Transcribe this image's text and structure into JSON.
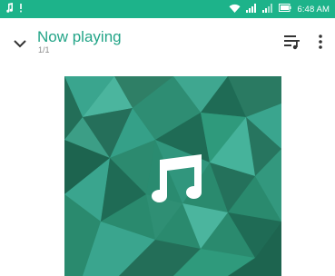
{
  "status_bar": {
    "time": "6:48 AM",
    "background": "#1db38a",
    "icons": [
      "music-note-icon",
      "alert-icon",
      "wifi-icon",
      "sim1-signal-icon",
      "sim2-signal-icon",
      "battery-icon"
    ]
  },
  "toolbar": {
    "title": "Now playing",
    "subtitle": "1/1",
    "accent": "#22a487",
    "icons": [
      "chevron-down-icon",
      "queue-music-icon",
      "more-vert-icon"
    ]
  },
  "album_art": {
    "icon": "music-note-icon",
    "colors": [
      "#1f6b55",
      "#2a8a6e",
      "#3aa58e",
      "#4bb59e",
      "#2f9a7c"
    ]
  }
}
